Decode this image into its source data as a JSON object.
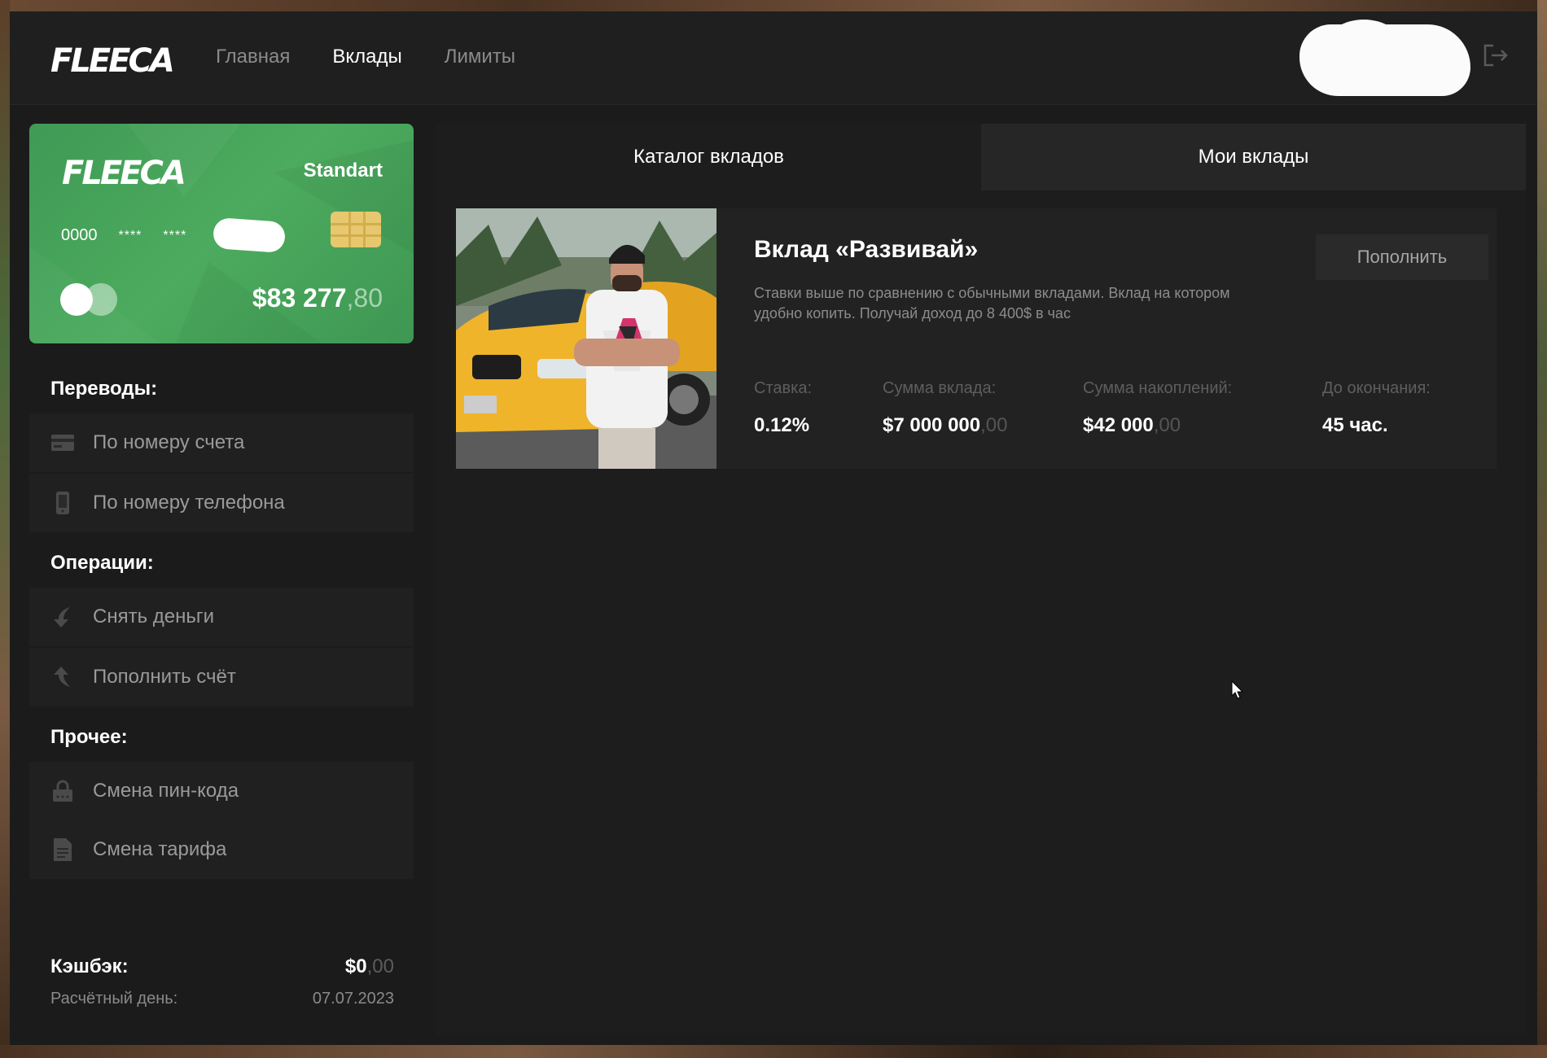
{
  "header": {
    "logo": "FLEECA",
    "nav": [
      {
        "label": "Главная"
      },
      {
        "label": "Вклады"
      },
      {
        "label": "Лимиты"
      }
    ]
  },
  "card": {
    "logo": "FLEECA",
    "tier": "Standart",
    "number_first": "0000",
    "number_mask_1": "****",
    "number_mask_2": "****",
    "balance_main": "$83 277",
    "balance_cents": ",80"
  },
  "sidebar": {
    "transfers_title": "Переводы:",
    "transfers": [
      {
        "label": "По номеру счета",
        "icon": "card-icon"
      },
      {
        "label": "По номеру телефона",
        "icon": "phone-icon"
      }
    ],
    "operations_title": "Операции:",
    "operations": [
      {
        "label": "Снять деньги",
        "icon": "arrow-down-icon"
      },
      {
        "label": "Пополнить счёт",
        "icon": "arrow-up-icon"
      }
    ],
    "other_title": "Прочее:",
    "other": [
      {
        "label": "Смена пин-кода",
        "icon": "lock-icon"
      },
      {
        "label": "Смена тарифа",
        "icon": "document-icon"
      }
    ],
    "cashback_label": "Кэшбэк:",
    "cashback_main": "$0",
    "cashback_cents": ",00",
    "calc_day_label": "Расчётный день:",
    "calc_day_value": "07.07.2023"
  },
  "main": {
    "tabs": [
      {
        "label": "Каталог вкладов"
      },
      {
        "label": "Мои вклады"
      }
    ],
    "deposit": {
      "title": "Вклад «Развивай»",
      "description": "Ставки выше по сравнению с обычными вкладами. Вклад на котором удобно копить. Получай доход до 8 400$ в час",
      "button": "Пополнить",
      "rate_label": "Ставка:",
      "rate_value": "0.12%",
      "sum_label": "Сумма вклада:",
      "sum_main": "$7 000 000",
      "sum_cents": ",00",
      "savings_label": "Сумма накоплений:",
      "savings_main": "$42 000",
      "savings_cents": ",00",
      "end_label": "До окончания:",
      "end_value": "45 час."
    }
  },
  "colors": {
    "card_green": "#4cab5e",
    "background": "#1b1b1b",
    "chip": "#e7c86f"
  }
}
